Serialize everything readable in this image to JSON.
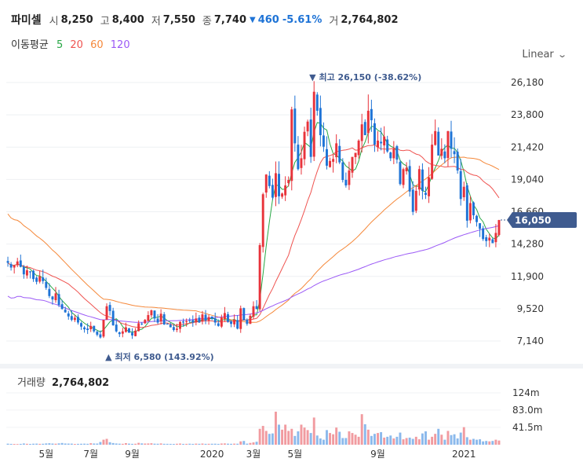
{
  "header": {
    "name": "파미셀",
    "open_label": "시",
    "open": "8,250",
    "high_label": "고",
    "high": "8,400",
    "low_label": "저",
    "low": "7,550",
    "close_label": "종",
    "close": "7,740",
    "change_arrow": "▼",
    "change": "460",
    "change_pct": "-5.61%",
    "volume_label": "거",
    "volume": "2,764,802"
  },
  "moving_avg": {
    "label": "이동평균",
    "periods": [
      {
        "value": "5",
        "color": "#27a745"
      },
      {
        "value": "20",
        "color": "#ef5350"
      },
      {
        "value": "60",
        "color": "#f5883a"
      },
      {
        "value": "120",
        "color": "#9b59f6"
      }
    ]
  },
  "scale_selector": {
    "label": "Linear"
  },
  "volume_panel": {
    "label": "거래량",
    "value": "2,764,802"
  },
  "colors": {
    "up": "#e8333b",
    "down": "#1e73d6",
    "up_vol": "#f19ba0",
    "down_vol": "#8bb9ec",
    "ma5": "#27a745",
    "ma20": "#ef5350",
    "ma60": "#f5883a",
    "ma120": "#9b59f6",
    "current_price_tag": "#3f5b8f"
  },
  "chart_data": {
    "type": "candlestick",
    "price_axis": {
      "ticks": [
        26180,
        23800,
        21420,
        19040,
        16660,
        14280,
        11900,
        9520,
        7140
      ],
      "labels": [
        "26,180",
        "23,800",
        "21,420",
        "19,040",
        "16,660",
        "14,280",
        "11,900",
        "9,520",
        "7,140"
      ]
    },
    "volume_axis": {
      "ticks": [
        124,
        83,
        41.5
      ],
      "labels": [
        "124m",
        "83.0m",
        "41.5m"
      ]
    },
    "x_labels": [
      {
        "label": "5월",
        "index": 12
      },
      {
        "label": "7월",
        "index": 26
      },
      {
        "label": "9월",
        "index": 39
      },
      {
        "label": "2020",
        "index": 64
      },
      {
        "label": "3월",
        "index": 77
      },
      {
        "label": "5월",
        "index": 90
      },
      {
        "label": "9월",
        "index": 116
      },
      {
        "label": "2021",
        "index": 143
      }
    ],
    "high_marker": {
      "label": "▼ 최고 26,150 (-38.62%)",
      "index": 95,
      "value": 26150
    },
    "low_marker": {
      "label": "▲ 최저 6,580 (143.92%)",
      "index": 33,
      "value": 6580
    },
    "current_price": {
      "value": 16050,
      "label": "16,050"
    },
    "close": [
      12900,
      12550,
      12700,
      13000,
      12600,
      12050,
      12350,
      12200,
      11700,
      11500,
      11900,
      11550,
      11050,
      10450,
      10200,
      10650,
      9800,
      9500,
      9250,
      8950,
      8700,
      8850,
      8500,
      8200,
      8000,
      7950,
      8250,
      7850,
      7600,
      7400,
      8700,
      9700,
      9350,
      8300,
      7850,
      7650,
      7850,
      8150,
      7750,
      7550,
      7900,
      8450,
      8400,
      8700,
      9050,
      9400,
      8800,
      8500,
      9150,
      8350,
      8400,
      8150,
      7950,
      8050,
      8550,
      8500,
      8600,
      8650,
      8500,
      8800,
      8500,
      9100,
      8650,
      8900,
      8800,
      8500,
      8250,
      8850,
      9200,
      8550,
      8400,
      8700,
      8050,
      9550,
      8700,
      8400,
      9000,
      9700,
      9500,
      14200,
      17950,
      19400,
      18550,
      17700,
      19500,
      17800,
      18000,
      18600,
      19000,
      24200,
      21700,
      19800,
      20600,
      22550,
      23300,
      20700,
      25500,
      24100,
      22300,
      21450,
      20050,
      20400,
      20550,
      21700,
      20300,
      19000,
      18600,
      19700,
      20700,
      21000,
      21900,
      23100,
      22300,
      24100,
      23400,
      21600,
      21900,
      21700,
      22200,
      21100,
      20600,
      21300,
      20500,
      18700,
      19800,
      19900,
      18150,
      16650,
      18200,
      19800,
      18200,
      17900,
      19200,
      21600,
      22600,
      20800,
      21300,
      20600,
      22600,
      21300,
      20900,
      19700,
      17600,
      18500,
      16000,
      17300,
      16400,
      15900,
      15400,
      14650,
      14500,
      14750,
      14350,
      15100,
      16050
    ],
    "volume": [
      2.5,
      2,
      1.8,
      1.6,
      2,
      3,
      2.2,
      1.9,
      2.4,
      2.6,
      2.1,
      2.3,
      3.1,
      3.5,
      2.8,
      2.4,
      3.2,
      4.1,
      2.9,
      2.7,
      2.6,
      1.8,
      2.1,
      2.3,
      2.5,
      2.2,
      3.6,
      2.9,
      2.8,
      6.5,
      12,
      14,
      6,
      4,
      3,
      2.5,
      2.2,
      3.8,
      2.6,
      2.1,
      2.3,
      4.5,
      3.2,
      2.8,
      3,
      3.5,
      2.5,
      2.3,
      3.1,
      2.2,
      2.1,
      2,
      1.9,
      2.3,
      2.8,
      2,
      2.1,
      2.4,
      2,
      2.6,
      2.2,
      2.8,
      2.1,
      2.2,
      2.3,
      2.4,
      2,
      2.9,
      3.1,
      2.5,
      2.2,
      2.6,
      2.4,
      8,
      9,
      2.6,
      4.3,
      5.6,
      7.1,
      38,
      45,
      33,
      26,
      27,
      79,
      48,
      36,
      48,
      33,
      38,
      21,
      32,
      48,
      41,
      35,
      28,
      65,
      22,
      15,
      12,
      35,
      28,
      25,
      41,
      31,
      16,
      16,
      32,
      28,
      24,
      19,
      73,
      49,
      36,
      21,
      26,
      28,
      30,
      17,
      19,
      22,
      15,
      19,
      29,
      13,
      16,
      17,
      14,
      19,
      13,
      27,
      32,
      12,
      19,
      26,
      38,
      24,
      12,
      33,
      23,
      25,
      15,
      29,
      42,
      18,
      12,
      14,
      12,
      13,
      8,
      9,
      8,
      9,
      12,
      10
    ]
  }
}
